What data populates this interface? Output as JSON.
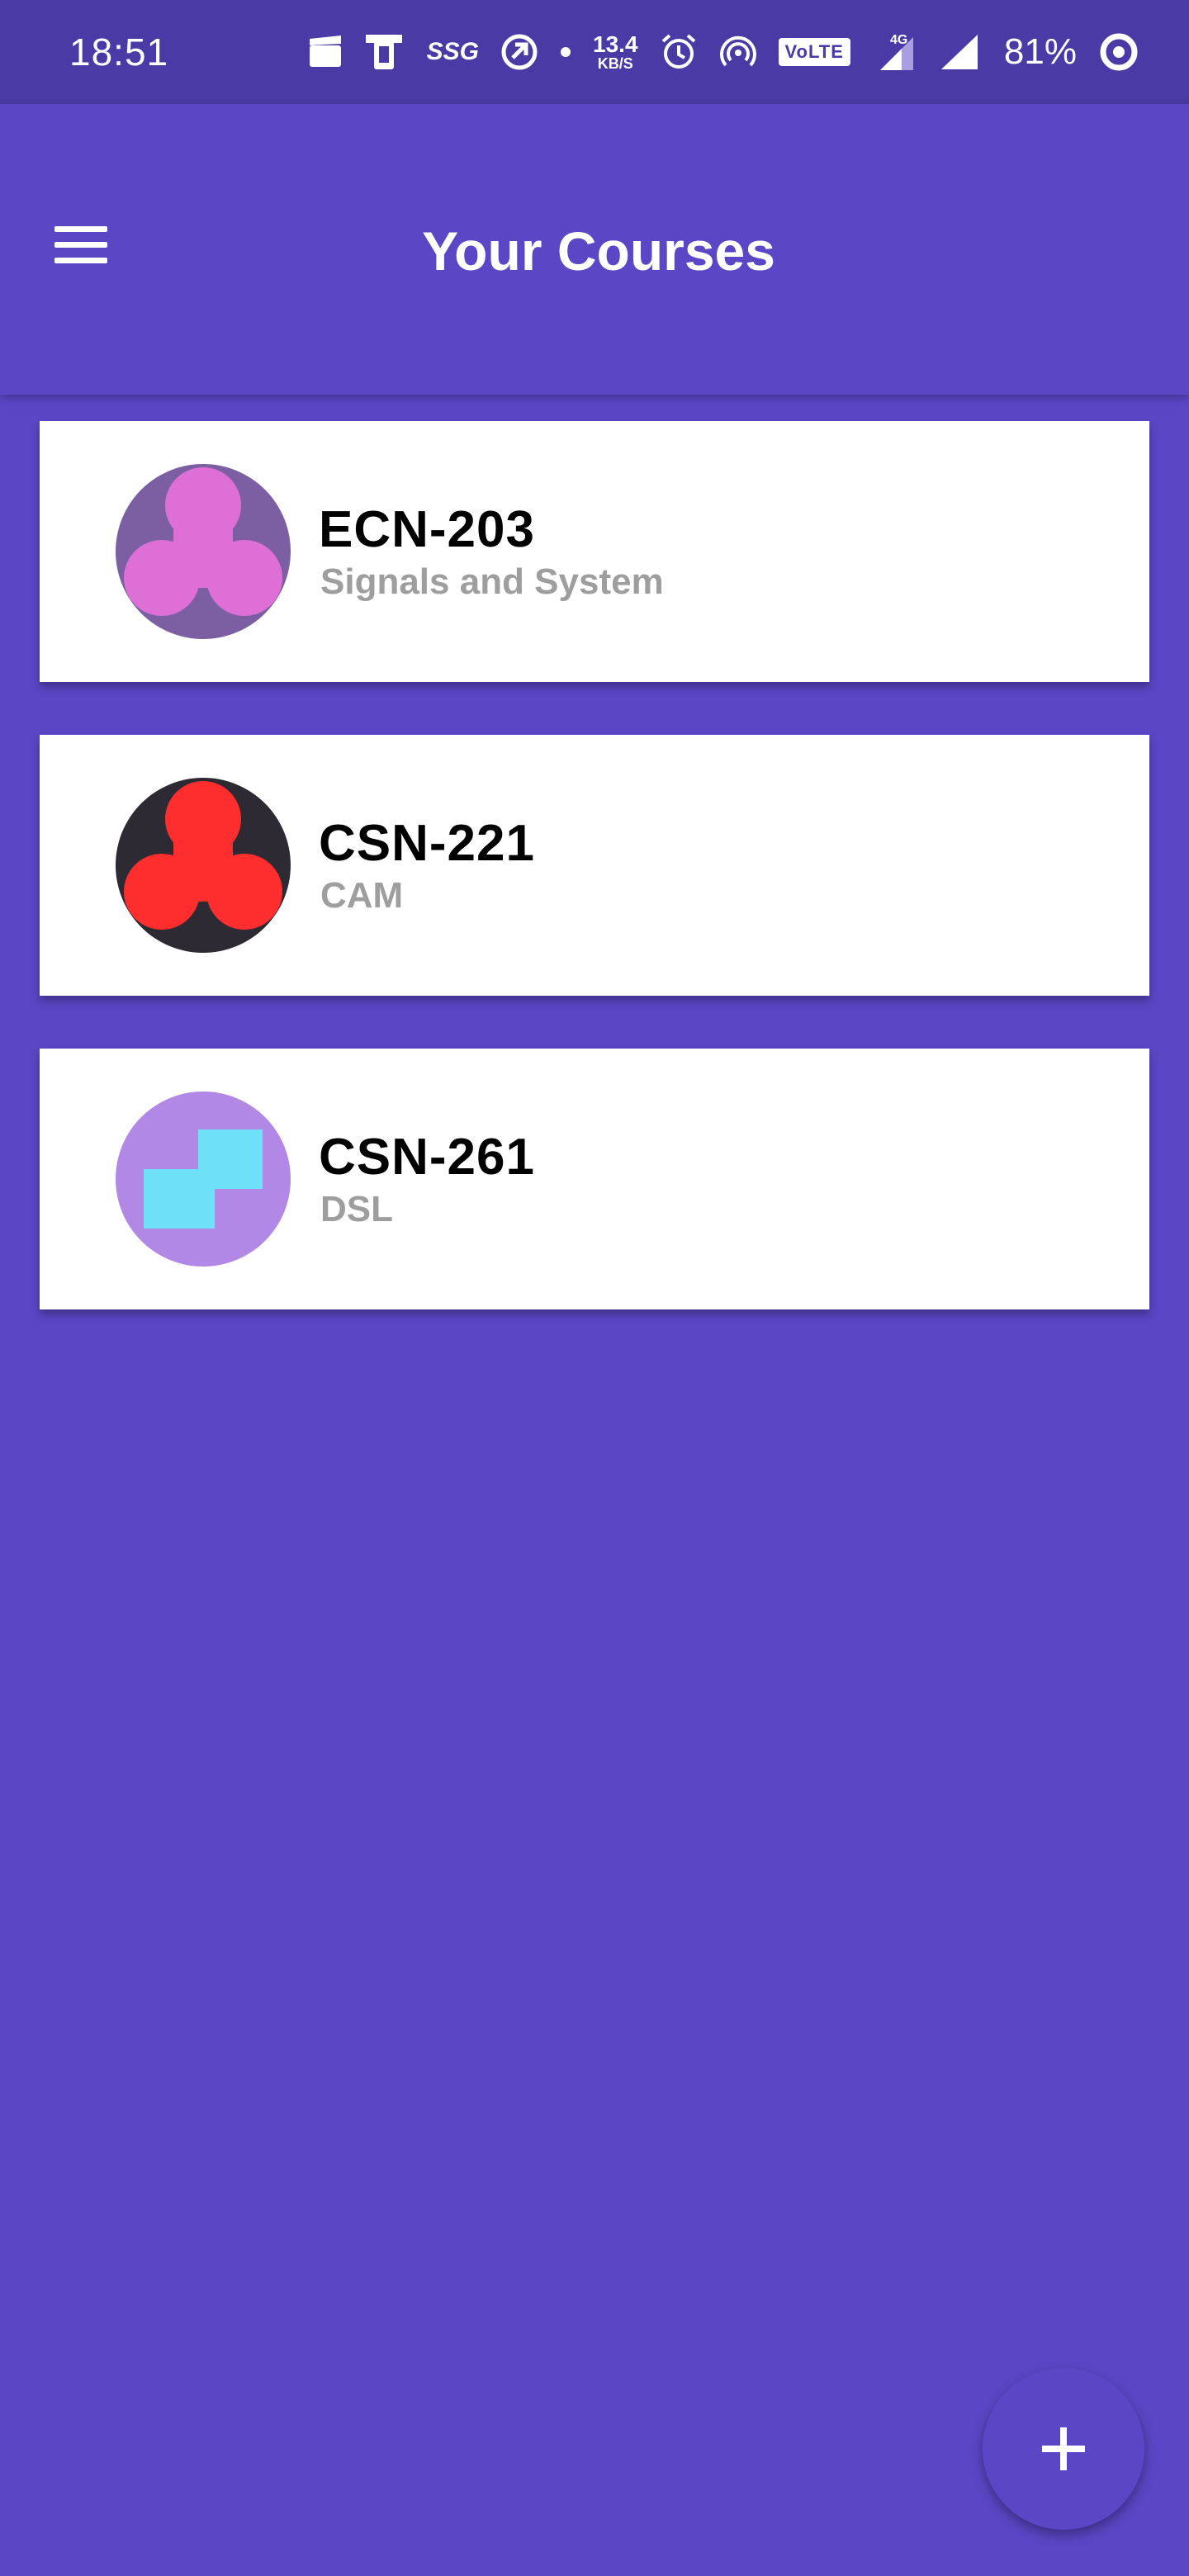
{
  "status_bar": {
    "time": "18:51",
    "speed_value": "13.4",
    "speed_unit": "KB/S",
    "ssg": "SSG",
    "volte": "VoLTE",
    "network_type": "4G",
    "battery": "81%"
  },
  "app_bar": {
    "title": "Your Courses",
    "menu_icon": "hamburger-menu-icon"
  },
  "courses": [
    {
      "code": "ECN-203",
      "name": "Signals and System",
      "avatar_bg": "#7c5fa3",
      "avatar_fg": "#de6fd6",
      "avatar_pattern": "trefoil"
    },
    {
      "code": "CSN-221",
      "name": "CAM",
      "avatar_bg": "#2e2a33",
      "avatar_fg": "#ff2e2e",
      "avatar_pattern": "trefoil"
    },
    {
      "code": "CSN-261",
      "name": "DSL",
      "avatar_bg": "#b288e6",
      "avatar_fg": "#6ee0f8",
      "avatar_pattern": "squares"
    }
  ],
  "fab": {
    "icon": "plus-icon"
  },
  "colors": {
    "primary": "#5b46c5",
    "status_bar": "#4a3aa6",
    "card": "#ffffff",
    "subtitle": "#9e9e9e"
  }
}
